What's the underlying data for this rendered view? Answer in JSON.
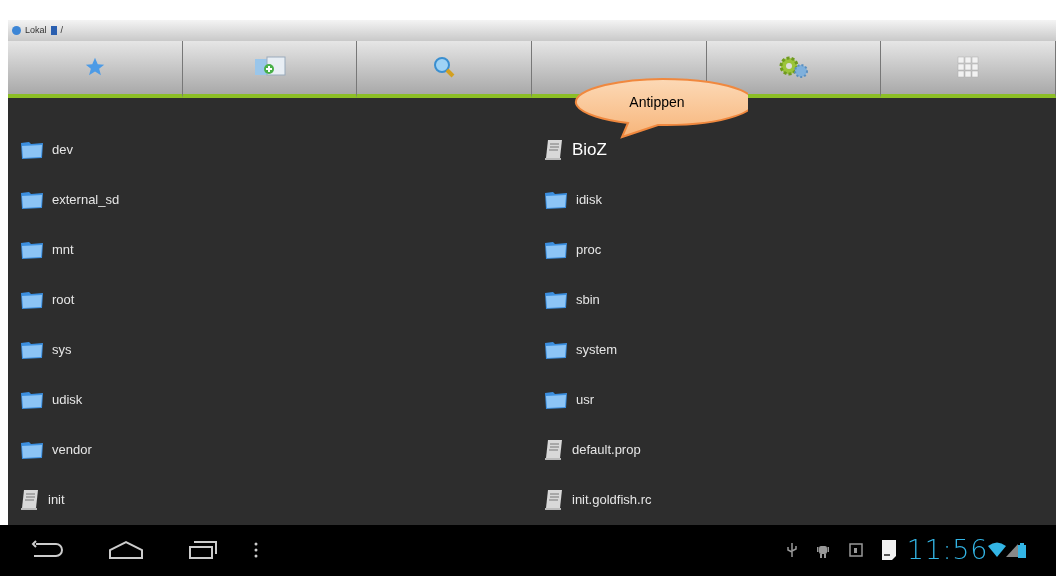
{
  "path_bar": {
    "location": "Lokal",
    "path": "/"
  },
  "toolbar": {
    "buttons": [
      {
        "kind": "star"
      },
      {
        "kind": "add"
      },
      {
        "kind": "search"
      },
      {
        "kind": "blank"
      },
      {
        "kind": "gears"
      },
      {
        "kind": "grid"
      }
    ]
  },
  "callout": {
    "text": "Antippen"
  },
  "files": [
    {
      "name": "dev",
      "kind": "folder",
      "emphasized": false
    },
    {
      "name": "BioZ",
      "kind": "file",
      "emphasized": true
    },
    {
      "name": "external_sd",
      "kind": "folder",
      "emphasized": false
    },
    {
      "name": "idisk",
      "kind": "folder",
      "emphasized": false
    },
    {
      "name": "mnt",
      "kind": "folder",
      "emphasized": false
    },
    {
      "name": "proc",
      "kind": "folder",
      "emphasized": false
    },
    {
      "name": "root",
      "kind": "folder",
      "emphasized": false
    },
    {
      "name": "sbin",
      "kind": "folder",
      "emphasized": false
    },
    {
      "name": "sys",
      "kind": "folder",
      "emphasized": false
    },
    {
      "name": "system",
      "kind": "folder",
      "emphasized": false
    },
    {
      "name": "udisk",
      "kind": "folder",
      "emphasized": false
    },
    {
      "name": "usr",
      "kind": "folder",
      "emphasized": false
    },
    {
      "name": "vendor",
      "kind": "folder",
      "emphasized": false
    },
    {
      "name": "default.prop",
      "kind": "file",
      "emphasized": false
    },
    {
      "name": "init",
      "kind": "file",
      "emphasized": false
    },
    {
      "name": "init.goldfish.rc",
      "kind": "file",
      "emphasized": false
    }
  ],
  "status_bar": {
    "time": "11:56"
  }
}
